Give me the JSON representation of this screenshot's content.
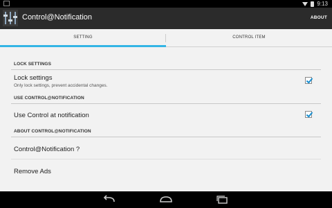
{
  "status_bar": {
    "time": "9:13"
  },
  "app": {
    "title": "Control@Notification",
    "about_label": "ABOUT"
  },
  "tabs": [
    {
      "label": "SETTING"
    },
    {
      "label": "CONTROL ITEM"
    }
  ],
  "settings": {
    "lock_category": "LOCK SETTINGS",
    "lock_title": "Lock settings",
    "lock_summary": "Only lock settings, prevent accidental changes.",
    "lock_checked": true,
    "control_category": "USE CONTROL@NOTIFICATION",
    "control_title": "Use Control at notification",
    "control_checked": true,
    "about_category": "ABOUT CONTROL@NOTIFICATION",
    "about_item": "Control@Notification ?",
    "remove_ads": "Remove Ads"
  },
  "colors": {
    "accent": "#33b5e5",
    "action_bar": "#2b2b2b",
    "background": "#f2f2f2"
  },
  "nav_icons": [
    "back-icon",
    "home-icon",
    "recent-apps-icon"
  ]
}
